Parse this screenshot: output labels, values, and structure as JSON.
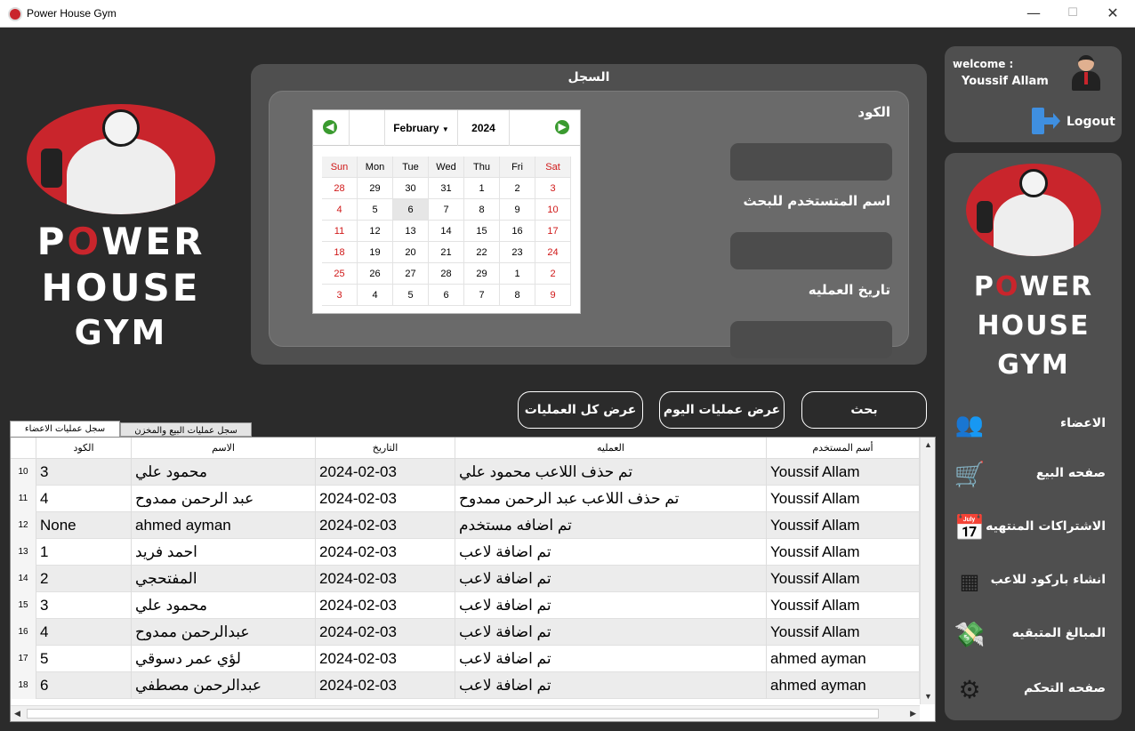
{
  "window": {
    "title": "Power House Gym",
    "minimize": "—",
    "maximize": "☐",
    "close": "✕"
  },
  "brand": {
    "line1_p": "P",
    "line1_o": "O",
    "line1_rest": "WER",
    "line2": "HOUSE",
    "line3": "GYM"
  },
  "search": {
    "title": "السجل",
    "code_label": "الكود",
    "user_label": "اسم المتستخدم للبحث",
    "date_label": "تاريخ العمليه"
  },
  "calendar": {
    "month": "February",
    "year": "2024",
    "prev": "◀",
    "next": "▶",
    "dow": [
      "Sun",
      "Mon",
      "Tue",
      "Wed",
      "Thu",
      "Fri",
      "Sat"
    ],
    "weeks": [
      [
        "28",
        "29",
        "30",
        "31",
        "1",
        "2",
        "3"
      ],
      [
        "4",
        "5",
        "6",
        "7",
        "8",
        "9",
        "10"
      ],
      [
        "11",
        "12",
        "13",
        "14",
        "15",
        "16",
        "17"
      ],
      [
        "18",
        "19",
        "20",
        "21",
        "22",
        "23",
        "24"
      ],
      [
        "25",
        "26",
        "27",
        "28",
        "29",
        "1",
        "2"
      ],
      [
        "3",
        "4",
        "5",
        "6",
        "7",
        "8",
        "9"
      ]
    ],
    "selected_day": "6"
  },
  "actions": {
    "search": "بحث",
    "today": "عرض عمليات اليوم",
    "all": "عرض كل العمليات"
  },
  "tabs": {
    "members_log": "سجل عمليات الاعضاء",
    "sales_log": "سجل عمليات البيع والمخزن"
  },
  "table": {
    "headers": {
      "code": "الكود",
      "name": "الاسم",
      "date": "التاريخ",
      "operation": "العمليه",
      "user": "أسم المستخدم"
    },
    "rows": [
      {
        "num": "10",
        "code": "3",
        "name": "محمود علي",
        "date": "2024-02-03",
        "operation": "تم حذف اللاعب محمود علي",
        "user": "Youssif Allam"
      },
      {
        "num": "11",
        "code": "4",
        "name": "عبد الرحمن ممدوح",
        "date": "2024-02-03",
        "operation": "تم حذف اللاعب عبد الرحمن ممدوح",
        "user": "Youssif Allam"
      },
      {
        "num": "12",
        "code": "None",
        "name": "ahmed ayman",
        "date": "2024-02-03",
        "operation": "تم اضافه مستخدم",
        "user": "Youssif Allam"
      },
      {
        "num": "13",
        "code": "1",
        "name": "احمد فريد",
        "date": "2024-02-03",
        "operation": "تم اضافة لاعب",
        "user": "Youssif Allam"
      },
      {
        "num": "14",
        "code": "2",
        "name": "المفتحجي",
        "date": "2024-02-03",
        "operation": "تم اضافة لاعب",
        "user": "Youssif Allam"
      },
      {
        "num": "15",
        "code": "3",
        "name": "محمود علي",
        "date": "2024-02-03",
        "operation": "تم اضافة لاعب",
        "user": "Youssif Allam"
      },
      {
        "num": "16",
        "code": "4",
        "name": "عبدالرحمن ممدوح",
        "date": "2024-02-03",
        "operation": "تم اضافة لاعب",
        "user": "Youssif Allam"
      },
      {
        "num": "17",
        "code": "5",
        "name": "لؤي عمر دسوقي",
        "date": "2024-02-03",
        "operation": "تم اضافة لاعب",
        "user": "ahmed ayman"
      },
      {
        "num": "18",
        "code": "6",
        "name": "عبدالرحمن مصطفي",
        "date": "2024-02-03",
        "operation": "تم اضافة لاعب",
        "user": "ahmed ayman"
      }
    ]
  },
  "user": {
    "welcome": "welcome :",
    "name": "Youssif Allam",
    "logout": "Logout"
  },
  "nav": {
    "members": "الاعضاء",
    "sales": "صفحه البيع",
    "expired": "الاشتراكات المنتهيه",
    "barcode": "انشاء باركود للاعب",
    "remaining": "المبالغ المتبقيه",
    "dashboard": "صفحه التحكم"
  }
}
